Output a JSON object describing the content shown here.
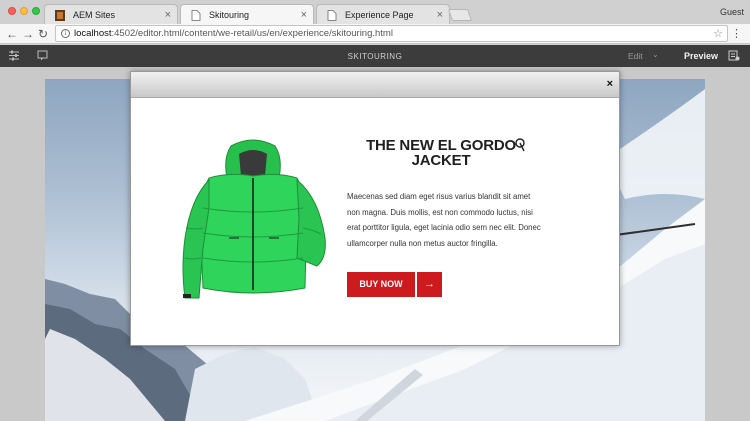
{
  "browser": {
    "tabs": [
      {
        "label": "AEM Sites",
        "active": false
      },
      {
        "label": "Skitouring",
        "active": true
      },
      {
        "label": "Experience Page",
        "active": false
      }
    ],
    "profile": "Guest",
    "url_host": "localhost",
    "url_rest": ":4502/editor.html/content/we-retail/us/en/experience/skitouring.html"
  },
  "editor": {
    "page_title": "SKITOURING",
    "mode_label": "Edit",
    "preview_label": "Preview"
  },
  "modal": {
    "heading_line1": "THE NEW EL GORDO",
    "heading_line2": "JACKET",
    "body_text": "Maecenas sed diam eget risus varius blandit sit amet non magna. Duis mollis, est non commodo luctus, nisi erat porttitor ligula, eget lacinia odio sem nec elit. Donec ullamcorper nulla non metus auctor fringilla.",
    "button_label": "BUY NOW",
    "close_glyph": "×",
    "button_arrow": "→"
  },
  "colors": {
    "accent_red": "#cc1a1f",
    "jacket_green": "#2ecc55",
    "editor_bar": "#3c3c3c"
  },
  "icons": {
    "toolbar_left": [
      "settings-sliders-icon",
      "annotate-icon"
    ],
    "toolbar_right": [
      "page-info-icon"
    ]
  }
}
